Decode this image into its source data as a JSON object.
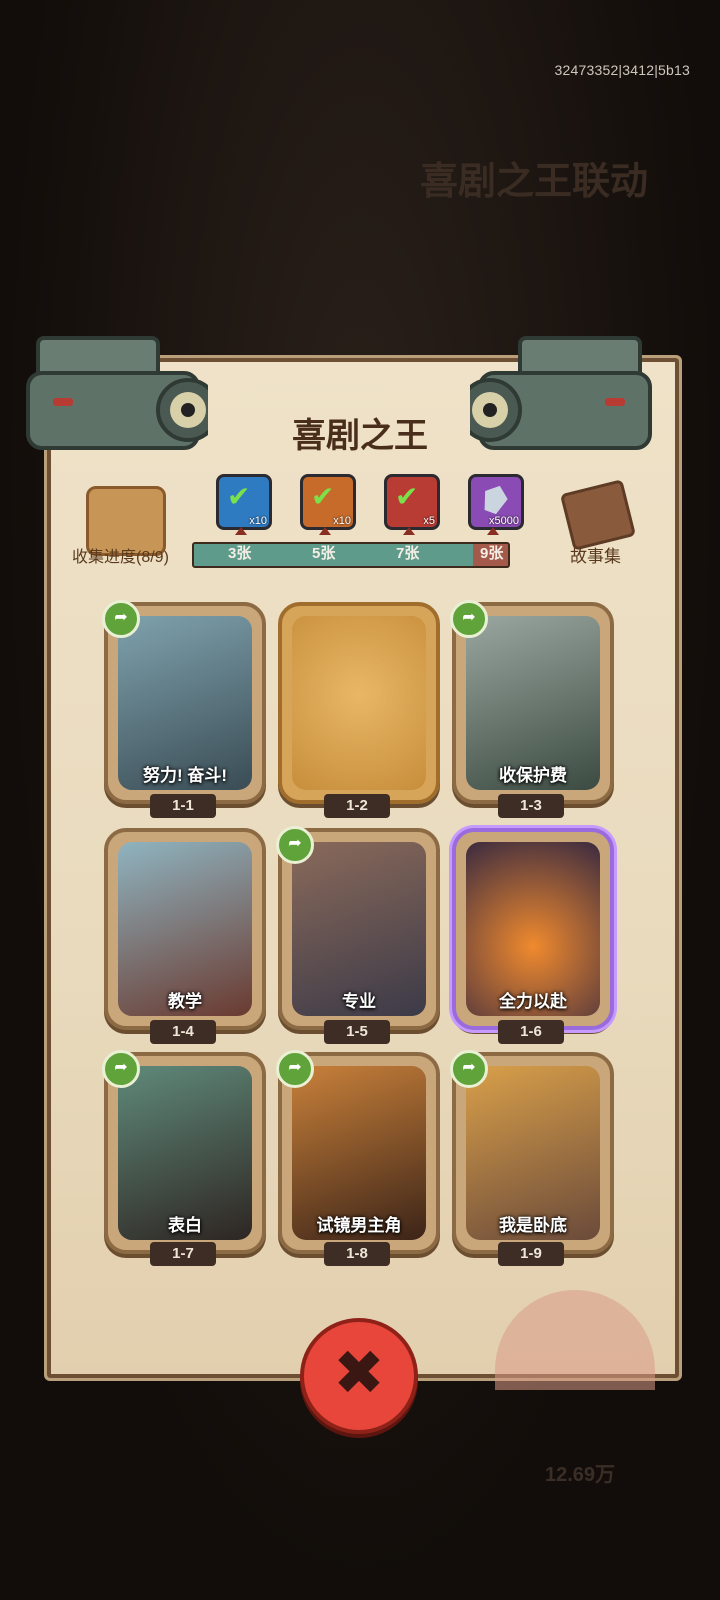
{
  "build": "32473352|3412|5b13",
  "background": {
    "event_title": "喜剧之王联动",
    "coins": "12.69万"
  },
  "panel": {
    "title": "喜剧之王"
  },
  "progress": {
    "collect_label": "收集进度(8/9)",
    "collected": 8,
    "total": 9,
    "story_label": "故事集",
    "milestones": [
      {
        "label": "3张",
        "reward_qty": "x10",
        "icon": "blue-chest-checked"
      },
      {
        "label": "5张",
        "reward_qty": "x10",
        "icon": "orange-chest-checked"
      },
      {
        "label": "7张",
        "reward_qty": "x5",
        "icon": "red-orb-checked"
      },
      {
        "label": "9张",
        "reward_qty": "x5000",
        "icon": "diamond-gem"
      }
    ]
  },
  "cards": [
    {
      "id": "1-1",
      "name": "努力! 奋斗!",
      "shareable": true,
      "locked": false
    },
    {
      "id": "1-2",
      "name": "",
      "shareable": false,
      "locked": true
    },
    {
      "id": "1-3",
      "name": "收保护费",
      "shareable": true,
      "locked": false
    },
    {
      "id": "1-4",
      "name": "教学",
      "shareable": false,
      "locked": false
    },
    {
      "id": "1-5",
      "name": "专业",
      "shareable": true,
      "locked": false
    },
    {
      "id": "1-6",
      "name": "全力以赴",
      "shareable": false,
      "locked": false
    },
    {
      "id": "1-7",
      "name": "表白",
      "shareable": true,
      "locked": false
    },
    {
      "id": "1-8",
      "name": "试镜男主角",
      "shareable": true,
      "locked": false
    },
    {
      "id": "1-9",
      "name": "我是卧底",
      "shareable": true,
      "locked": false
    }
  ],
  "close_icon": "close-x-icon"
}
